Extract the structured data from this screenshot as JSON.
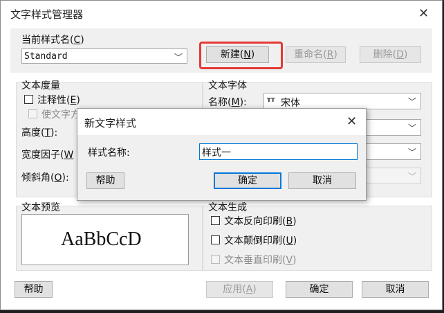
{
  "window": {
    "title": "文字样式管理器",
    "close_glyph": "✕"
  },
  "current_style": {
    "label": "当前样式名(C)",
    "label_text": "当前样式名(",
    "label_key": "C",
    "label_end": ")",
    "value": "Standard"
  },
  "buttons_top": {
    "new": {
      "text": "新建(",
      "key": "N",
      "end": ")"
    },
    "rename": {
      "text": "重命名(",
      "key": "R",
      "end": ")"
    },
    "delete": {
      "text": "删除(",
      "key": "D",
      "end": ")"
    }
  },
  "text_metrics": {
    "title": "文本度量",
    "annotative": {
      "text": "注释性(",
      "key": "E",
      "end": ")"
    },
    "match_orientation": "使文字方",
    "height": {
      "text": "高度(",
      "key": "T",
      "end": "):"
    },
    "width_factor": {
      "text": "宽度因子(",
      "key": "W",
      "end": ""
    },
    "oblique": {
      "text": "倾斜角(",
      "key": "O",
      "end": "):"
    }
  },
  "text_font": {
    "title": "文本字体",
    "name_label": {
      "text": "名称(",
      "key": "M",
      "end": "):"
    },
    "font_icon": "truetype-icon",
    "font_icon_glyph": "ᴛт",
    "font_value": "宋体"
  },
  "preview": {
    "title": "文本预览",
    "sample": "AaBbCcD"
  },
  "text_generation": {
    "title": "文本生成",
    "reverse": {
      "text": "文本反向印刷(",
      "key": "B",
      "end": ")"
    },
    "upside": {
      "text": "文本颠倒印刷(",
      "key": "U",
      "end": ")"
    },
    "vertical": {
      "text": "文本垂直印刷(",
      "key": "V",
      "end": ")"
    }
  },
  "buttons_bottom": {
    "help": "帮助",
    "apply": {
      "text": "应用(",
      "key": "A",
      "end": ")"
    },
    "ok": "确定",
    "cancel": "取消"
  },
  "dialog": {
    "title": "新文字样式",
    "close_glyph": "✕",
    "name_label": "样式名称:",
    "name_value": "样式一",
    "help": "帮助",
    "ok": "确定",
    "cancel": "取消"
  },
  "colors": {
    "highlight": "#e53935",
    "focus": "#0078d7"
  }
}
